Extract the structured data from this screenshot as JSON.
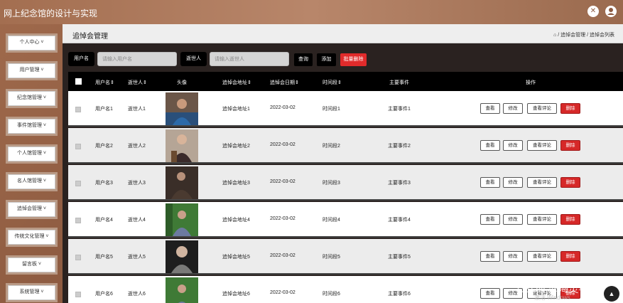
{
  "app": {
    "title": "网上纪念馆的设计与实现"
  },
  "header_icons": [
    "shrink-icon",
    "user-icon"
  ],
  "sidebar": {
    "items": [
      {
        "label": "个人中心 ˅"
      },
      {
        "label": "用户管理 ˅"
      },
      {
        "label": "纪念馆管理 ˅"
      },
      {
        "label": "事件馆管理 ˅"
      },
      {
        "label": "个人馆管理 ˅"
      },
      {
        "label": "名人馆管理 ˅"
      },
      {
        "label": "追悼会管理 ˅"
      },
      {
        "label": "传统文化管理 ˅"
      },
      {
        "label": "留言板 ˅"
      },
      {
        "label": "系统管理 ˅"
      }
    ]
  },
  "page": {
    "title": "追悼会管理",
    "breadcrumb": "⌂ / 追悼会管理 / 追悼会列表"
  },
  "search": {
    "username_label": "用户名",
    "username_placeholder": "请输入用户名",
    "deceased_label": "逝世人",
    "deceased_placeholder": "请输入逝世人",
    "query_button": "查询",
    "add_button": "添加",
    "batch_delete_button": "批量删除"
  },
  "table": {
    "headers": {
      "username": "用户名⇕",
      "deceased": "逝世人⇕",
      "avatar": "头像",
      "address": "追悼会地址⇕",
      "date": "追悼会日期⇕",
      "timeslot": "时间段⇕",
      "events": "主要事件",
      "actions": "操作"
    },
    "action_labels": {
      "view": "查看",
      "edit": "修改",
      "comments": "查看评论",
      "delete": "删除"
    },
    "rows": [
      {
        "username": "用户名1",
        "deceased": "逝世人1",
        "address": "追悼会地址1",
        "date": "2022-03-02",
        "timeslot": "时间段1",
        "events": "主要事件1"
      },
      {
        "username": "用户名2",
        "deceased": "逝世人2",
        "address": "追悼会地址2",
        "date": "2022-03-02",
        "timeslot": "时间段2",
        "events": "主要事件2"
      },
      {
        "username": "用户名3",
        "deceased": "逝世人3",
        "address": "追悼会地址3",
        "date": "2022-03-02",
        "timeslot": "时间段3",
        "events": "主要事件3"
      },
      {
        "username": "用户名4",
        "deceased": "逝世人4",
        "address": "追悼会地址4",
        "date": "2022-03-02",
        "timeslot": "时间段4",
        "events": "主要事件4"
      },
      {
        "username": "用户名5",
        "deceased": "逝世人5",
        "address": "追悼会地址5",
        "date": "2022-03-02",
        "timeslot": "时间段5",
        "events": "主要事件5"
      },
      {
        "username": "用户名6",
        "deceased": "逝世人6",
        "address": "追悼会地址6",
        "date": "2022-03-02",
        "timeslot": "时间段6",
        "events": "主要事件6"
      }
    ]
  },
  "overlay": {
    "watermark": "CSDN @海灵学姐",
    "activation": "激活 Windows"
  }
}
